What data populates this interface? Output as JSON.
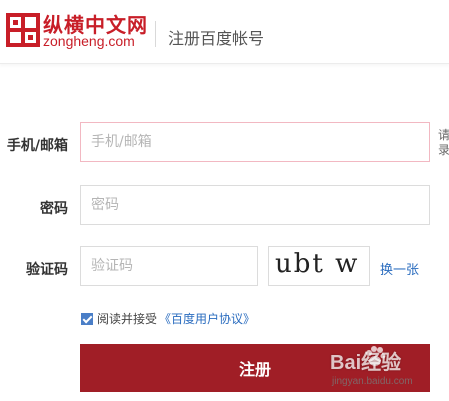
{
  "header": {
    "logo_cn": "纵横中文网",
    "logo_en": "zongheng.com",
    "title": "注册百度帐号"
  },
  "form": {
    "account_label": "手机/邮箱",
    "account_placeholder": "手机/邮箱",
    "account_hint": "请录",
    "password_label": "密码",
    "password_placeholder": "密码",
    "captcha_label": "验证码",
    "captcha_placeholder": "验证码",
    "captcha_text": "ubt w",
    "refresh_label": "换一张",
    "agree_text": "阅读并接受",
    "agree_link": "《百度用户协议》",
    "agree_checked": true,
    "submit_label": "注册"
  },
  "watermark": {
    "brand": "Bai经验",
    "url": "jingyan.baidu.com"
  },
  "colors": {
    "brand_red": "#c81e28",
    "button_red": "#a01e26",
    "link_blue": "#2a6cbf",
    "focus_border": "#f2b8c2"
  },
  "icons": {
    "logo": "zongheng-logo-icon",
    "checkbox": "checkbox-checked-icon",
    "watermark": "baidu-paw-icon"
  }
}
